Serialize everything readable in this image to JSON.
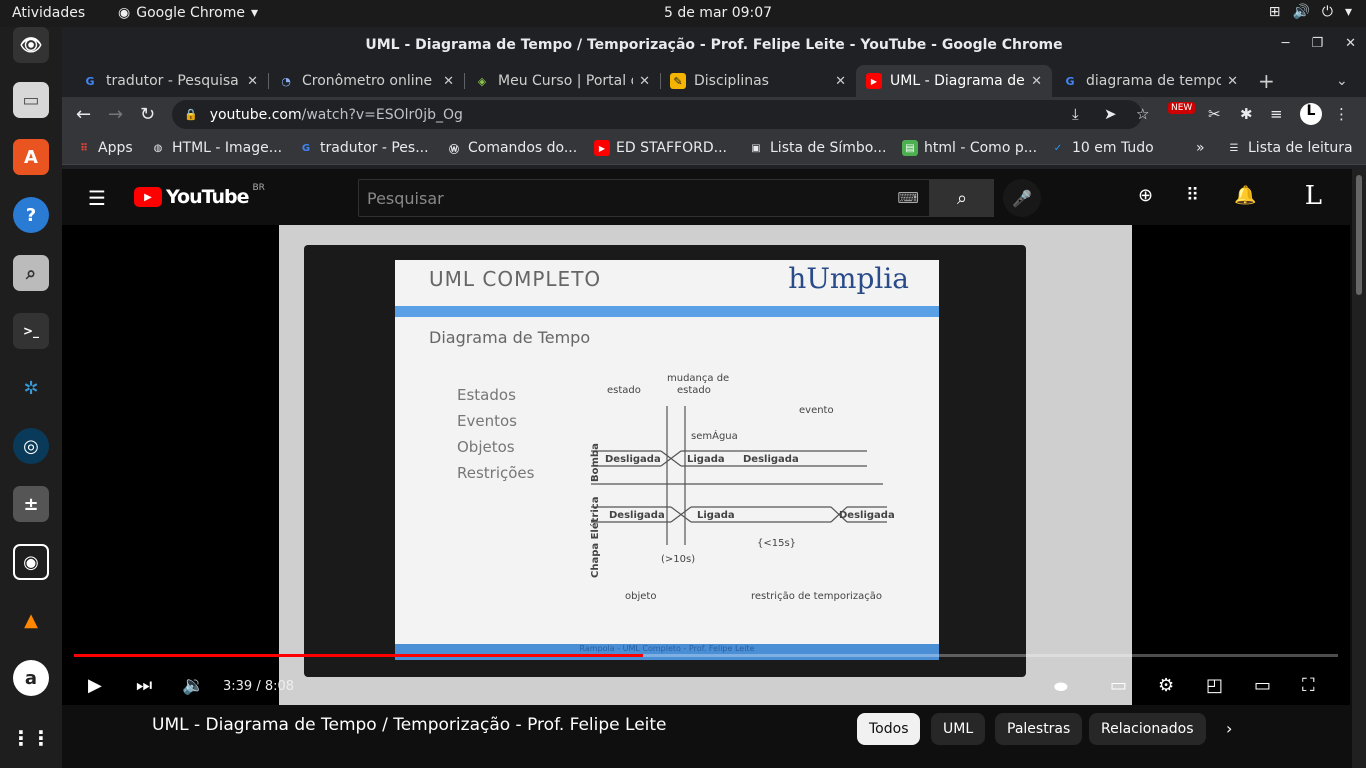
{
  "os": {
    "activities": "Atividades",
    "app": "Google Chrome",
    "clock": "5 de mar  09:07"
  },
  "window": {
    "title": "UML - Diagrama de Tempo / Temporização - Prof. Felipe Leite - YouTube - Google Chrome"
  },
  "tabs": [
    {
      "label": "tradutor - Pesquisa",
      "icon": "google-icon"
    },
    {
      "label": "Cronômetro online",
      "icon": "stopwatch-icon"
    },
    {
      "label": "Meu Curso | Portal do",
      "icon": "course-icon"
    },
    {
      "label": "Disciplinas",
      "icon": "edit-icon"
    },
    {
      "label": "UML - Diagrama de",
      "icon": "youtube-icon"
    },
    {
      "label": "diagrama de tempo",
      "icon": "google-icon"
    }
  ],
  "address": {
    "domain": "youtube.com",
    "path": "/watch?v=ESOlr0jb_Og"
  },
  "bookmarks": [
    "Apps",
    "HTML - Image...",
    "tradutor - Pes...",
    "Comandos do...",
    "ED STAFFORD...",
    "Lista de Símbo...",
    "html - Como p...",
    "10 em Tudo",
    "»",
    "Lista de leitura"
  ],
  "youtube": {
    "logo": "YouTube",
    "region": "BR",
    "search_placeholder": "Pesquisar",
    "avatar": "L"
  },
  "slide": {
    "title": "UML COMPLETO",
    "brand": "hUmplia",
    "subtitle": "Diagrama de Tempo",
    "items": [
      "Estados",
      "Eventos",
      "Objetos",
      "Restrições"
    ],
    "notes": [
      "estado",
      "mudança de",
      "estado",
      "evento",
      "semÁgua",
      "Bomba",
      "Chapa Elétrica",
      "objeto",
      "restrição de temporização"
    ],
    "states": [
      "Desligada",
      "Ligada",
      "Desligada",
      "Desligada",
      "Ligada",
      "Desligada"
    ],
    "constraints": [
      "(>10s)",
      "{<15s}"
    ],
    "footer": "Rampola - UML Completo - Prof. Felipe Leite"
  },
  "player": {
    "time": "3:39 / 8:08",
    "progress": 0.45
  },
  "video": {
    "title": "UML - Diagrama de Tempo / Temporização - Prof. Felipe Leite"
  },
  "chips": [
    "Todos",
    "UML",
    "Palestras",
    "Relacionados"
  ],
  "colors": {
    "accent": "#ff0000",
    "chrome_bg": "#202124",
    "toolbar": "#35363a"
  }
}
